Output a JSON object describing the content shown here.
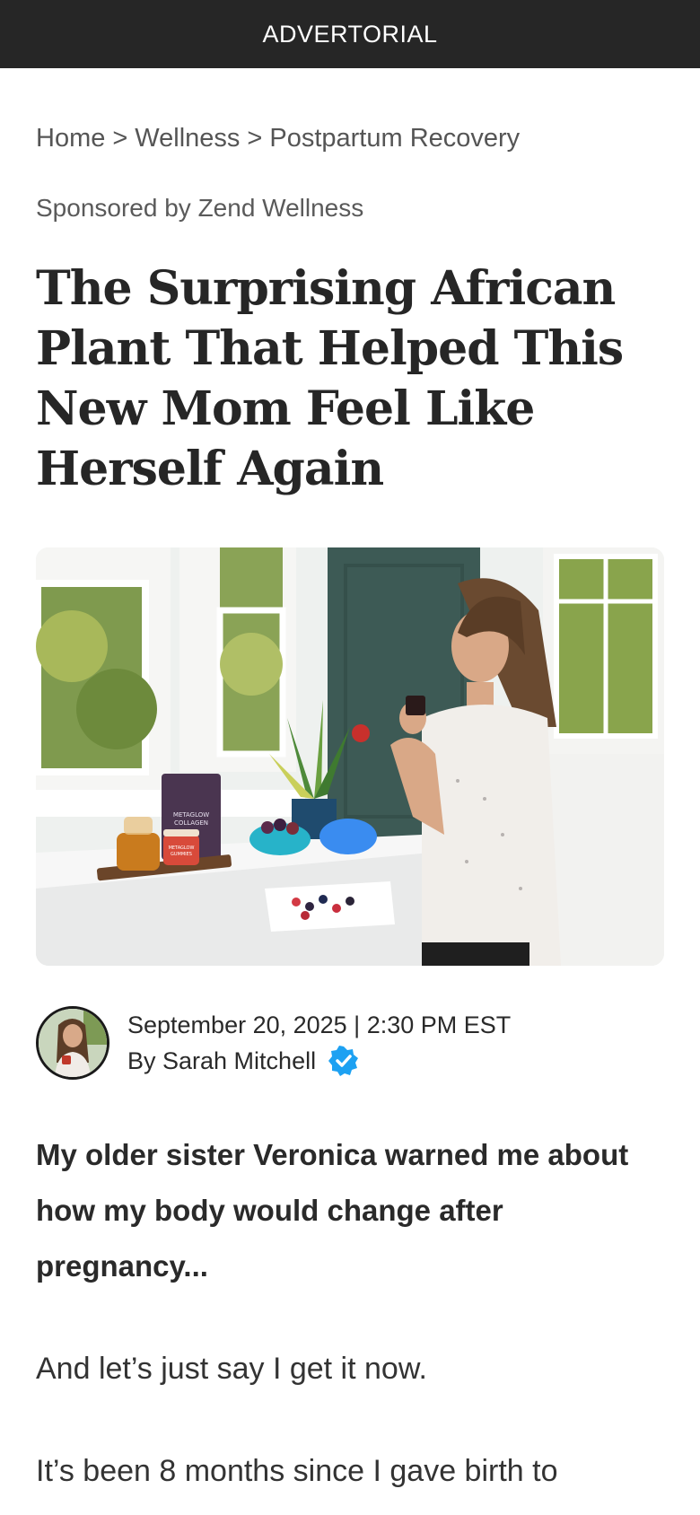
{
  "banner": {
    "label": "ADVERTORIAL"
  },
  "breadcrumb": {
    "items": [
      "Home",
      "Wellness",
      "Postpartum Recovery"
    ],
    "separator": ">"
  },
  "sponsored": "Sponsored by Zend Wellness",
  "headline": "The Surprising African Plant That Helped This New Mom Feel Like Herself Again",
  "hero_image": {
    "product_label_line1": "METAGLOW",
    "product_label_line2": "COLLAGEN",
    "jar_label_line1": "METAGLOW",
    "jar_label_line2": "GUMMIES"
  },
  "byline": {
    "datetime": "September 20, 2025 | 2:30 PM EST",
    "author": "By Sarah Mitchell"
  },
  "article": {
    "lead": "My older sister Veronica warned me about how my body would change after pregnancy...",
    "p1": "And let’s just say I get it now.",
    "p2": "It’s been 8 months since I gave birth to"
  },
  "colors": {
    "banner_bg": "#262626",
    "verified_badge": "#1da1f2"
  }
}
